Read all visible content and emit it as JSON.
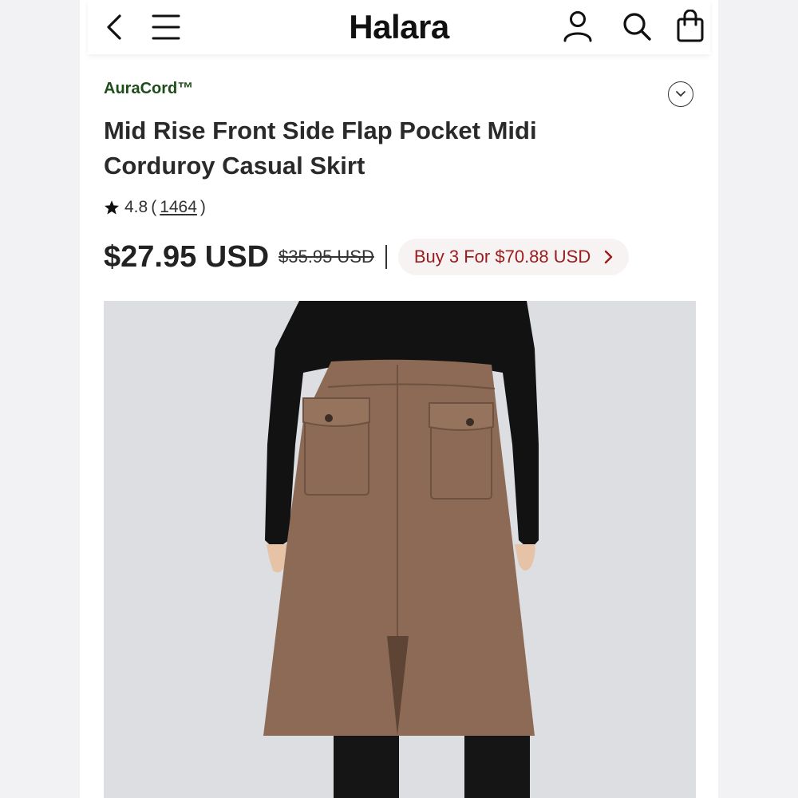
{
  "header": {
    "logo": "Halara",
    "icons": [
      "back-icon",
      "menu-icon",
      "account-icon",
      "search-icon",
      "shopping-bag-icon"
    ]
  },
  "product": {
    "brand": "AuraCord™",
    "title": "Mid Rise Front Side Flap Pocket Midi Corduroy Casual Skirt",
    "rating": "4.8",
    "rating_open": "(",
    "review_count": "1464",
    "rating_close": ")",
    "price": "$27.95 USD",
    "original_price": "$35.95 USD",
    "bundle_offer": "Buy 3 For $70.88 USD",
    "image_alt": "Model wearing brown corduroy midi skirt with black top"
  },
  "colors": {
    "brand_green": "#1f4d1a",
    "offer_red": "#9b1c1c",
    "skirt_brown": "#8c6a55",
    "image_bg": "#dcdee2"
  }
}
